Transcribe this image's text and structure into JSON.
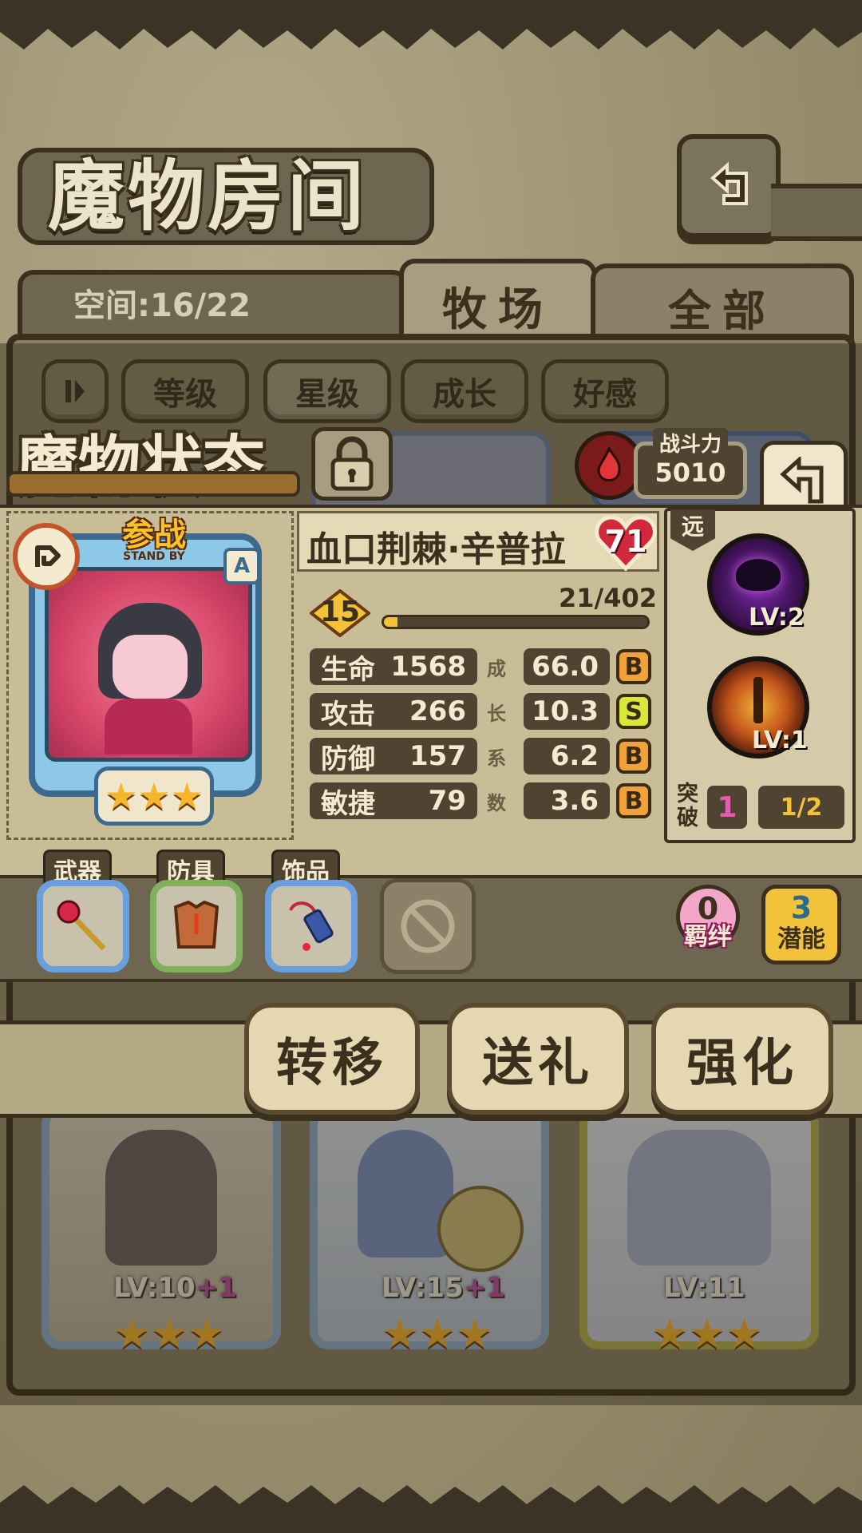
{
  "header": {
    "title": "魔物房间",
    "back_icon": "return-icon"
  },
  "tabs_row": {
    "space_label": "空间:16/22",
    "tab_farm": "牧场",
    "tab_all": "全部"
  },
  "sort_buttons": {
    "toggle_icon": "pause-sort-icon",
    "level": "等级",
    "star": "星级",
    "growth": "成长",
    "affection": "好感"
  },
  "status": {
    "title": "魔物状态",
    "power_label": "战斗力",
    "power_value": "5010"
  },
  "monster": {
    "name": "血口荆棘·辛普拉",
    "heart_value": "71",
    "stand_by_cn": "参战",
    "stand_by_en": "STAND BY",
    "rank_letter": "A",
    "stars": 3,
    "level": "15",
    "exp_text": "21/402",
    "exp_fraction": 0.052,
    "stats": [
      {
        "label": "生命",
        "value": "1568",
        "coef": "66.0",
        "grade": "B",
        "grade_color": "#f0a23a"
      },
      {
        "label": "攻击",
        "value": "266",
        "coef": "10.3",
        "grade": "S",
        "grade_color": "#d8e83a"
      },
      {
        "label": "防御",
        "value": "157",
        "coef": "6.2",
        "grade": "B",
        "grade_color": "#f0a23a"
      },
      {
        "label": "敏捷",
        "value": "79",
        "coef": "3.6",
        "grade": "B",
        "grade_color": "#f0a23a"
      }
    ],
    "growth_chars": [
      "成",
      "长",
      "系",
      "数"
    ],
    "range_tag": "远",
    "skills": [
      {
        "icon": "shadow-beast-skill-icon",
        "level": "LV:2"
      },
      {
        "icon": "flame-sword-skill-icon",
        "level": "LV:1"
      }
    ],
    "breakthrough_label": "突破",
    "breakthrough_value": "1",
    "breakthrough_progress": "1/2"
  },
  "equipment": {
    "weapon_label": "武器",
    "armor_label": "防具",
    "accessory_label": "饰品",
    "bond_value": "0",
    "bond_label": "羁绊",
    "potential_value": "3",
    "potential_label": "潜能"
  },
  "actions": {
    "transfer": "转移",
    "gift": "送礼",
    "enhance": "强化"
  },
  "bottom_cards": [
    {
      "level": "LV:10",
      "bonus": "+1",
      "stars": 3
    },
    {
      "level": "LV:15",
      "bonus": "+1",
      "stars": 3
    },
    {
      "level": "LV:11",
      "bonus": "",
      "stars": 3
    }
  ],
  "colors": {
    "panel": "#c9bd98",
    "accent_red": "#c8263a",
    "bar_gold": "#f2c23a"
  }
}
